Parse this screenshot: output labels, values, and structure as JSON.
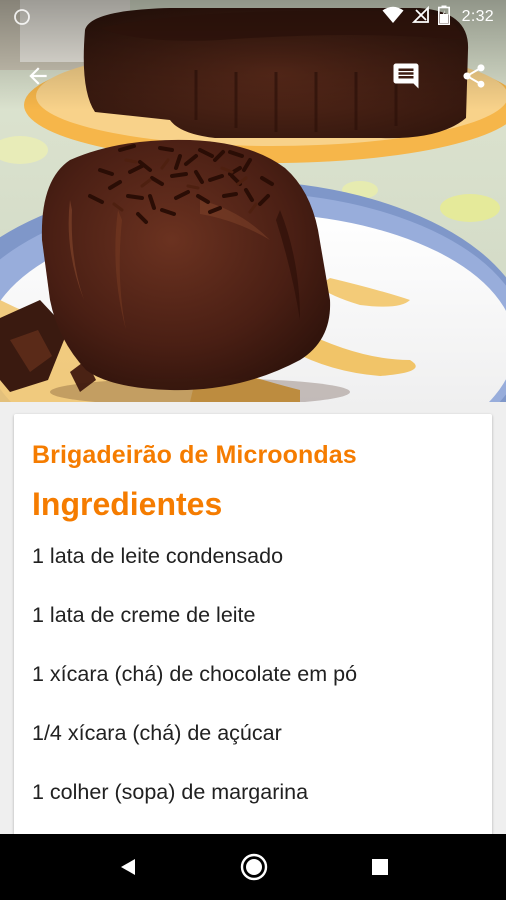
{
  "status_bar": {
    "time": "2:32",
    "icons": [
      "circle-status-icon",
      "wifi-icon",
      "no-signal-icon",
      "battery-icon"
    ]
  },
  "toolbar": {
    "icons": [
      "back-arrow-icon",
      "comment-icon",
      "share-icon"
    ],
    "icon_color": "#ffffff"
  },
  "recipe": {
    "title": "Brigadeirão de Microondas",
    "section_title": "Ingredientes",
    "ingredients": [
      "1 lata de leite condensado",
      "1 lata de creme de leite",
      "1 xícara (chá) de chocolate em pó",
      "1/4 xícara (chá) de açúcar",
      "1 colher (sopa) de margarina"
    ]
  },
  "nav_bar": {
    "icons": [
      "nav-back-icon",
      "nav-home-icon",
      "nav-recents-icon"
    ]
  },
  "colors": {
    "accent": "#f57c00",
    "text": "#212121",
    "card_bg": "#ffffff",
    "page_bg": "#efefef",
    "nav_bg": "#000000"
  }
}
